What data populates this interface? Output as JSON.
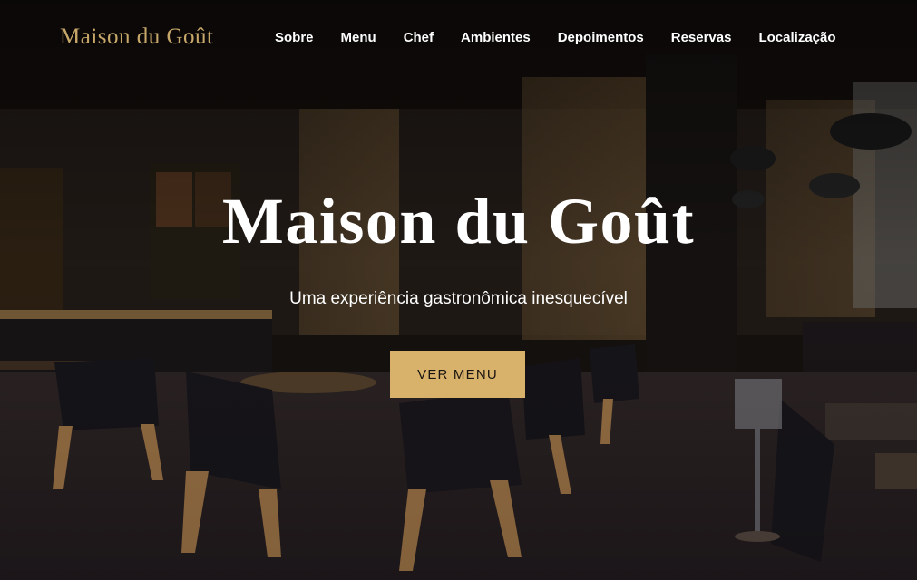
{
  "brand": {
    "logo_text": "Maison du Goût"
  },
  "nav": {
    "items": [
      {
        "label": "Sobre"
      },
      {
        "label": "Menu"
      },
      {
        "label": "Chef"
      },
      {
        "label": "Ambientes"
      },
      {
        "label": "Depoimentos"
      },
      {
        "label": "Reservas"
      },
      {
        "label": "Localização"
      }
    ]
  },
  "hero": {
    "title": "Maison du Goût",
    "subtitle": "Uma experiência gastronômica inesquecível",
    "cta_label": "VER MENU",
    "background": "restaurant-dining-room-photo"
  },
  "colors": {
    "accent": "#d8b16b",
    "logo": "#c7a86a",
    "text": "#ffffff"
  }
}
